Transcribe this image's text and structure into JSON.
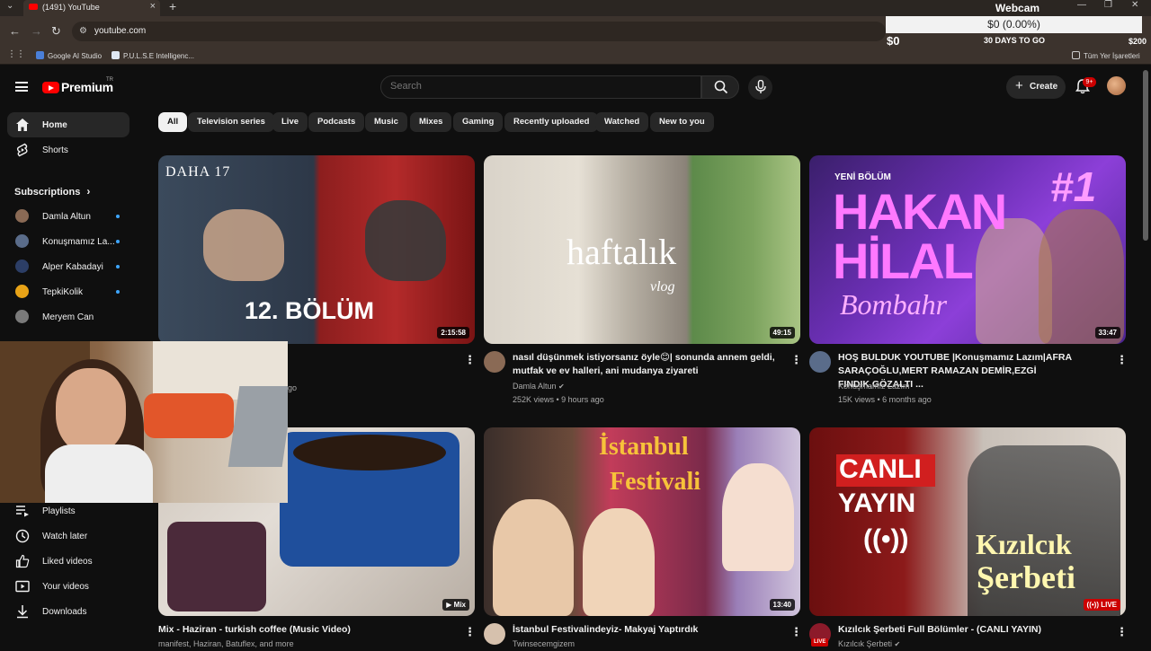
{
  "browser": {
    "tab_title": "(1491) YouTube",
    "url": "youtube.com",
    "bookmarks": [
      "Google AI Studio",
      "P.U.L.S.E Intelligenc...",
      "Tüm Yer İşaretleri"
    ]
  },
  "webcam_widget": {
    "title": "Webcam",
    "value": "$0 (0.00%)",
    "low": "$0",
    "period": "30 DAYS TO GO",
    "high": "$200"
  },
  "header": {
    "logo_text": "Premium",
    "logo_region": "TR",
    "search_placeholder": "Search",
    "create_label": "Create",
    "notifications_badge": "9+"
  },
  "sidebar": {
    "items": [
      {
        "label": "Home",
        "icon": "home-icon"
      },
      {
        "label": "Shorts",
        "icon": "shorts-icon"
      }
    ],
    "subscriptions_heading": "Subscriptions",
    "subscriptions": [
      {
        "label": "Damla Altun",
        "color": "#8a6a55"
      },
      {
        "label": "Konuşmamız La...",
        "color": "#5a6c8a"
      },
      {
        "label": "Alper Kabadayi",
        "color": "#2c3e66"
      },
      {
        "label": "TepkiKolik",
        "color": "#e8a317"
      },
      {
        "label": "Meryem Can",
        "color": "#7a7a7a"
      }
    ],
    "you_items": [
      {
        "label": "Playlists",
        "icon": "playlists-icon"
      },
      {
        "label": "Watch later",
        "icon": "clock-icon"
      },
      {
        "label": "Liked videos",
        "icon": "thumbs-up-icon"
      },
      {
        "label": "Your videos",
        "icon": "video-icon"
      },
      {
        "label": "Downloads",
        "icon": "download-icon"
      }
    ]
  },
  "chips": [
    "All",
    "Television series",
    "Live",
    "Podcasts",
    "Music",
    "Mixes",
    "Gaming",
    "Recently uploaded",
    "Watched",
    "New to you"
  ],
  "videos": [
    {
      "title": "",
      "meta1": "",
      "meta2": "go",
      "duration": "2:15:58",
      "overlay1": "DAHA 17",
      "overlay2": "12. BÖLÜM"
    },
    {
      "title": "nasıl düşünmek istiyorsanız öyle😊| sonunda annem geldi, mutfak ve ev halleri, ani mudanya ziyareti",
      "meta1": "Damla Altun",
      "meta2": "252K views • 9 hours ago",
      "duration": "49:15",
      "overlay1": "haftalık",
      "overlay2": "vlog"
    },
    {
      "title": "HOŞ BULDUK YOUTUBE |Konuşmamız Lazım|AFRA SARAÇOĞLU,MERT RAMAZAN DEMİR,EZGİ FINDIK,GÖZALTI ...",
      "meta1": "Konuşmamız Lazım",
      "meta2": "15K views • 6 months ago",
      "duration": "33:47",
      "overlay1": "YENİ BÖLÜM",
      "overlay2": "HAKAN",
      "overlay3": "HİLAL",
      "overlay4": "#1",
      "overlay5": "Bombahr"
    },
    {
      "title": "Mix - Haziran - turkish coffee (Music Video)",
      "meta1": "manifest, Haziran, Batuflex, and more",
      "duration": "Mix"
    },
    {
      "title": "İstanbul Festivalindeyiz- Makyaj Yaptırdık",
      "meta1": "Twinsecemgizem",
      "duration": "13:40",
      "overlay1": "İstanbul",
      "overlay2": "Festivali"
    },
    {
      "title": "Kızılcık Şerbeti Full Bölümler - (CANLI YAYIN)",
      "meta1": "Kızılcık Şerbeti",
      "duration": "LIVE",
      "overlay1": "CANLI",
      "overlay2": "YAYIN",
      "overlay3": "Kızılcık",
      "overlay4": "Şerbeti",
      "live_badge": "LIVE"
    }
  ]
}
